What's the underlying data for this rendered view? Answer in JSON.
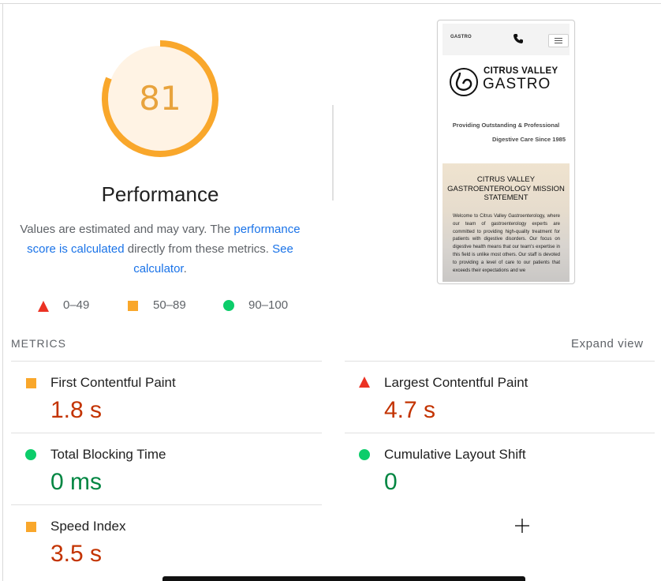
{
  "performance": {
    "score": "81",
    "score_fraction": 0.81,
    "title": "Performance",
    "desc_prefix": "Values are estimated and may vary. The ",
    "desc_link1": "performance score is calculated",
    "desc_middle": " directly from these metrics. ",
    "desc_link2": "See calculator",
    "desc_suffix": "."
  },
  "legend": [
    {
      "shape": "triangle",
      "range": "0–49"
    },
    {
      "shape": "square",
      "range": "50–89"
    },
    {
      "shape": "circle",
      "range": "90–100"
    }
  ],
  "screenshot": {
    "mini_logo": "GASTRO",
    "brand_line1": "CITRUS VALLEY",
    "brand_line2": "GASTRO",
    "tagline1": "Providing Outstanding & Professional",
    "tagline2": "Digestive Care Since 1985",
    "mission_title": "CITRUS VALLEY GASTROENTEROLOGY MISSION STATEMENT",
    "mission_body": "Welcome to Citrus Valley Gastroenterology, where our team of gastroenterology experts are committed to providing high-quality treatment for patients with digestive disorders. Our focus on digestive health means that our team's expertise in this field is unlike most others. Our staff is devoted to providing a level of care to our patients that exceeds their expectations and we"
  },
  "metrics": {
    "label": "METRICS",
    "expand": "Expand view",
    "items": [
      {
        "name": "First Contentful Paint",
        "value": "1.8 s",
        "rating": "average"
      },
      {
        "name": "Largest Contentful Paint",
        "value": "4.7 s",
        "rating": "fail"
      },
      {
        "name": "Total Blocking Time",
        "value": "0 ms",
        "rating": "pass"
      },
      {
        "name": "Cumulative Layout Shift",
        "value": "0",
        "rating": "pass"
      },
      {
        "name": "Speed Index",
        "value": "3.5 s",
        "rating": "average"
      }
    ]
  },
  "colors": {
    "average": "#f9a72b",
    "fail": "#eb3223",
    "pass": "#0ccd6a",
    "gauge_fill": "#fff3e4",
    "gauge_arc": "#f9a72b",
    "score_text": "#e8a33d",
    "value_red": "#c33300",
    "value_green": "#018642",
    "link": "#1a73e8"
  }
}
